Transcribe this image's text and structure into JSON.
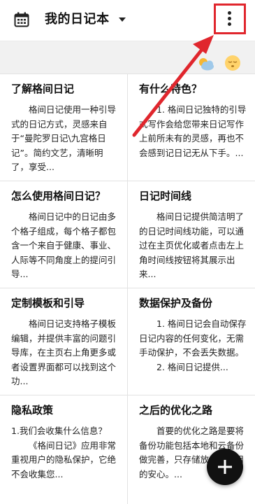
{
  "header": {
    "title": "我的日记本"
  },
  "icons": {
    "calendar": "calendar-icon",
    "dropdown": "caret-down-icon",
    "menu": "more-vertical-icon",
    "weather": "partly-cloudy-icon",
    "mood": "sleepy-face-icon",
    "add": "plus-icon"
  },
  "colors": {
    "annotation": "#e0262d",
    "fab": "#111111",
    "card_bg": "#ffffff",
    "grid_line": "#e2e2e2"
  },
  "cards": [
    {
      "title": "了解格间日记",
      "paragraphs": [
        "格间日记使用一种引导式的日记方式，灵感来自于“曼陀罗日记\\九宫格日记”。简约文艺，清晰明了，享受..."
      ]
    },
    {
      "title": "有什么特色？",
      "paragraphs": [
        "1. 格间日记独特的引导式写作会给您带来日记写作上前所未有的灵感，再也不会感到记日记无从下手。..."
      ]
    },
    {
      "title": "怎么使用格间日记？",
      "paragraphs": [
        "格间日记中的日记由多个格子组成，每个格子都包含一个来自于健康、事业、人际等不同角度上的提问引导..."
      ]
    },
    {
      "title": "日记时间线",
      "paragraphs": [
        "格间日记提供简洁明了的日记时间线功能，可以通过在主页优化或者点击左上角时间线按钮将其展示出来..."
      ]
    },
    {
      "title": "定制模板和引导",
      "paragraphs": [
        "格间日记支持格子模板编辑，并提供丰富的问题引导库，在主页右上角更多或者设置界面都可以找到这个功..."
      ]
    },
    {
      "title": "数据保护及备份",
      "paragraphs": [
        "1. 格间日记会自动保存日记内容的任何变化，无需手动保护，不会丢失数据。",
        "2. 格间日记提供..."
      ]
    },
    {
      "title": "隐私政策",
      "paragraphs": [
        "1.我们会收集什么信息？",
        "《格间日记》应用非常重视用户的隐私保护，它绝不会收集您..."
      ]
    },
    {
      "title": "之后的优化之路",
      "paragraphs": [
        "首要的优化之路是要将备份功能包括本地和云备份做完善，只存储放心，使用的安心。..."
      ]
    }
  ]
}
